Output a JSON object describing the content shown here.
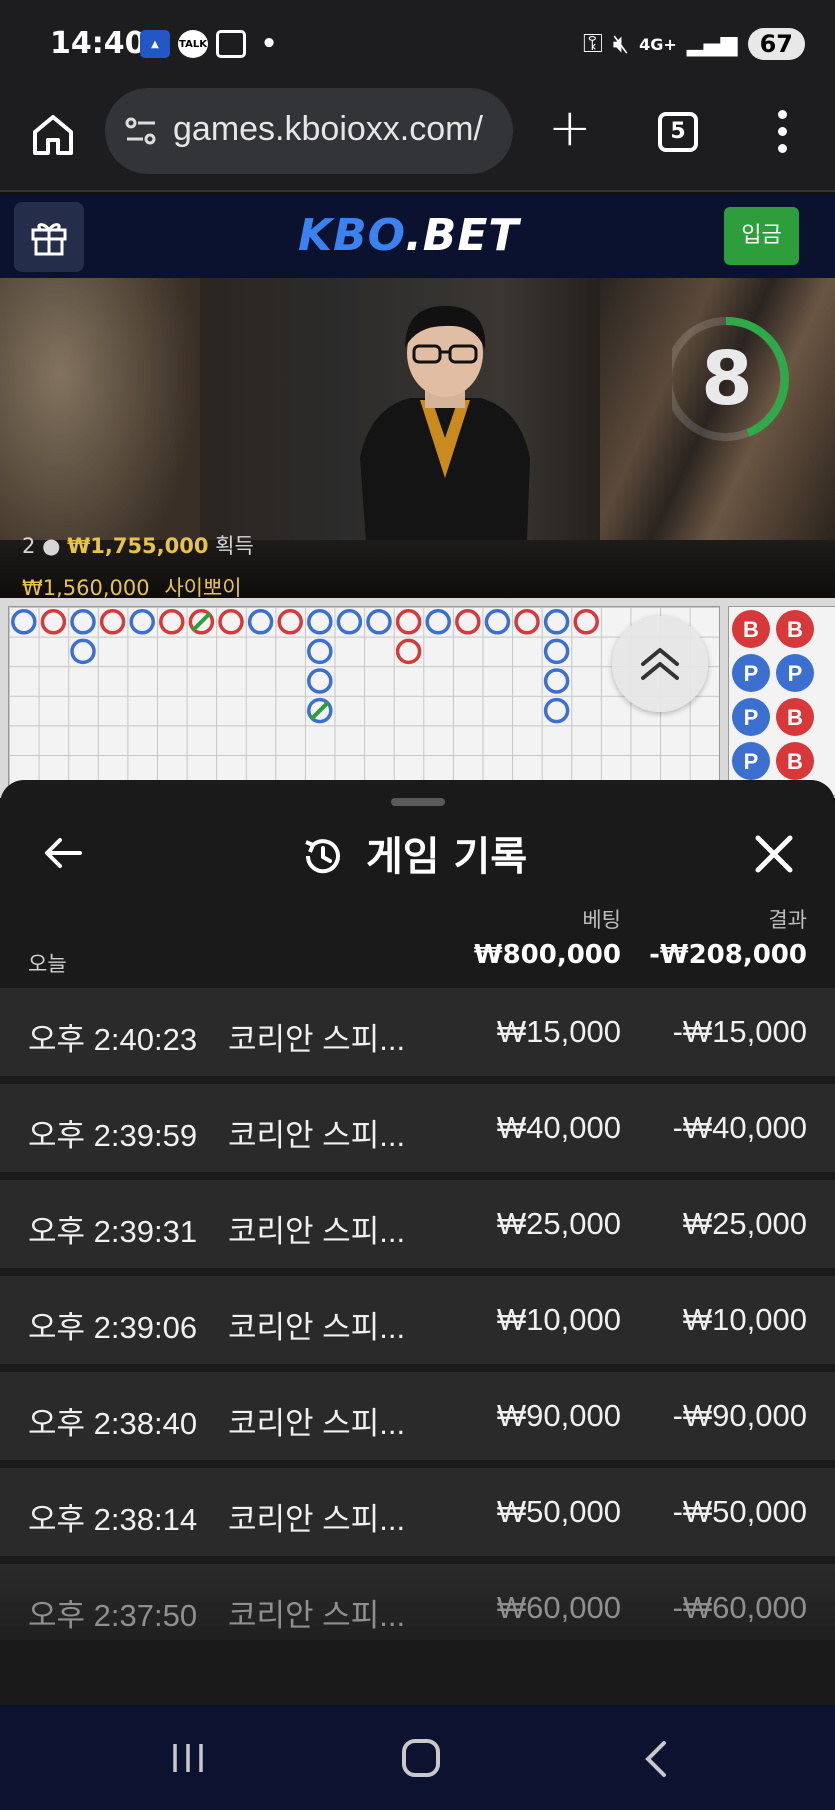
{
  "status_bar": {
    "time": "14:40",
    "network": "4G+",
    "battery": "67"
  },
  "browser": {
    "url": "games.kboioxx.com/",
    "tab_count": "5"
  },
  "site": {
    "logo_part1": "KBO",
    "logo_part2": ".BET",
    "deposit_label": "입금"
  },
  "video": {
    "countdown": "8",
    "player_count": "2",
    "total_win": "₩1,755,000",
    "win_label": "획득",
    "winner_amount": "₩1,560,000",
    "winner_name": "사이뽀이"
  },
  "history": {
    "title": "게임 기록",
    "col_bet": "베팅",
    "col_result": "결과",
    "today_label": "오늘",
    "today_bet": "₩800,000",
    "today_result": "-₩208,000",
    "rows": [
      {
        "time": "오후 2:40:23",
        "game": "코리안 스피...",
        "bet": "₩15,000",
        "result": "-₩15,000"
      },
      {
        "time": "오후 2:39:59",
        "game": "코리안 스피...",
        "bet": "₩40,000",
        "result": "-₩40,000"
      },
      {
        "time": "오후 2:39:31",
        "game": "코리안 스피...",
        "bet": "₩25,000",
        "result": "₩25,000"
      },
      {
        "time": "오후 2:39:06",
        "game": "코리안 스피...",
        "bet": "₩10,000",
        "result": "₩10,000"
      },
      {
        "time": "오후 2:38:40",
        "game": "코리안 스피...",
        "bet": "₩90,000",
        "result": "-₩90,000"
      },
      {
        "time": "오후 2:38:14",
        "game": "코리안 스피...",
        "bet": "₩50,000",
        "result": "-₩50,000"
      },
      {
        "time": "오후 2:37:50",
        "game": "코리안 스피...",
        "bet": "₩60,000",
        "result": "-₩60,000"
      }
    ]
  },
  "roadmap": {
    "bead_labels": [
      "B",
      "B",
      "P",
      "P",
      "P",
      "B",
      "P",
      "B"
    ]
  },
  "colors": {
    "banker": "#d8383a",
    "player": "#3b6fd0",
    "tie": "#2e9e3c",
    "deposit": "#2e9e3c",
    "logo_blue": "#3b82f0"
  }
}
